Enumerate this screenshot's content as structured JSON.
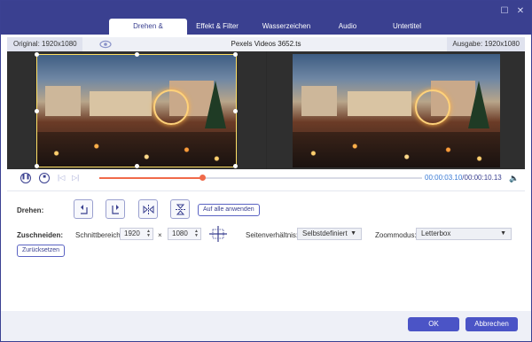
{
  "window": {
    "minimize_icon": "restore-icon",
    "close_icon": "close-icon"
  },
  "tabs": [
    {
      "label": "Drehen & Zuschneiden",
      "active": true
    },
    {
      "label": "Effekt & Filter",
      "active": false
    },
    {
      "label": "Wasserzeichen",
      "active": false
    },
    {
      "label": "Audio",
      "active": false
    },
    {
      "label": "Untertitel",
      "active": false
    }
  ],
  "infobar": {
    "original": "Original: 1920x1080",
    "filename": "Pexels Videos 3652.ts",
    "output": "Ausgabe: 1920x1080"
  },
  "playback": {
    "current_time": "00:00:03.10",
    "total_time": "/00:00:10.13",
    "progress": 0.32
  },
  "rotate": {
    "label": "Drehen:",
    "apply_all": "Auf alle anwenden",
    "buttons": [
      "rotate-left-icon",
      "rotate-right-icon",
      "flip-horizontal-icon",
      "flip-vertical-icon"
    ]
  },
  "crop": {
    "label": "Zuschneiden:",
    "area_label": "Schnittbereich:",
    "width": "1920",
    "times": "×",
    "height": "1080",
    "aspect_label": "Seitenverhältnis:",
    "aspect_value": "Selbstdefiniert",
    "zoom_label": "Zoommodus:",
    "zoom_value": "Letterbox",
    "reset": "Zurücksetzen"
  },
  "footer": {
    "ok": "OK",
    "cancel": "Abbrechen"
  },
  "colors": {
    "accent": "#3a4090",
    "button": "#4b54c6",
    "progress": "#f06a4a",
    "crop_frame": "#ffe066"
  }
}
